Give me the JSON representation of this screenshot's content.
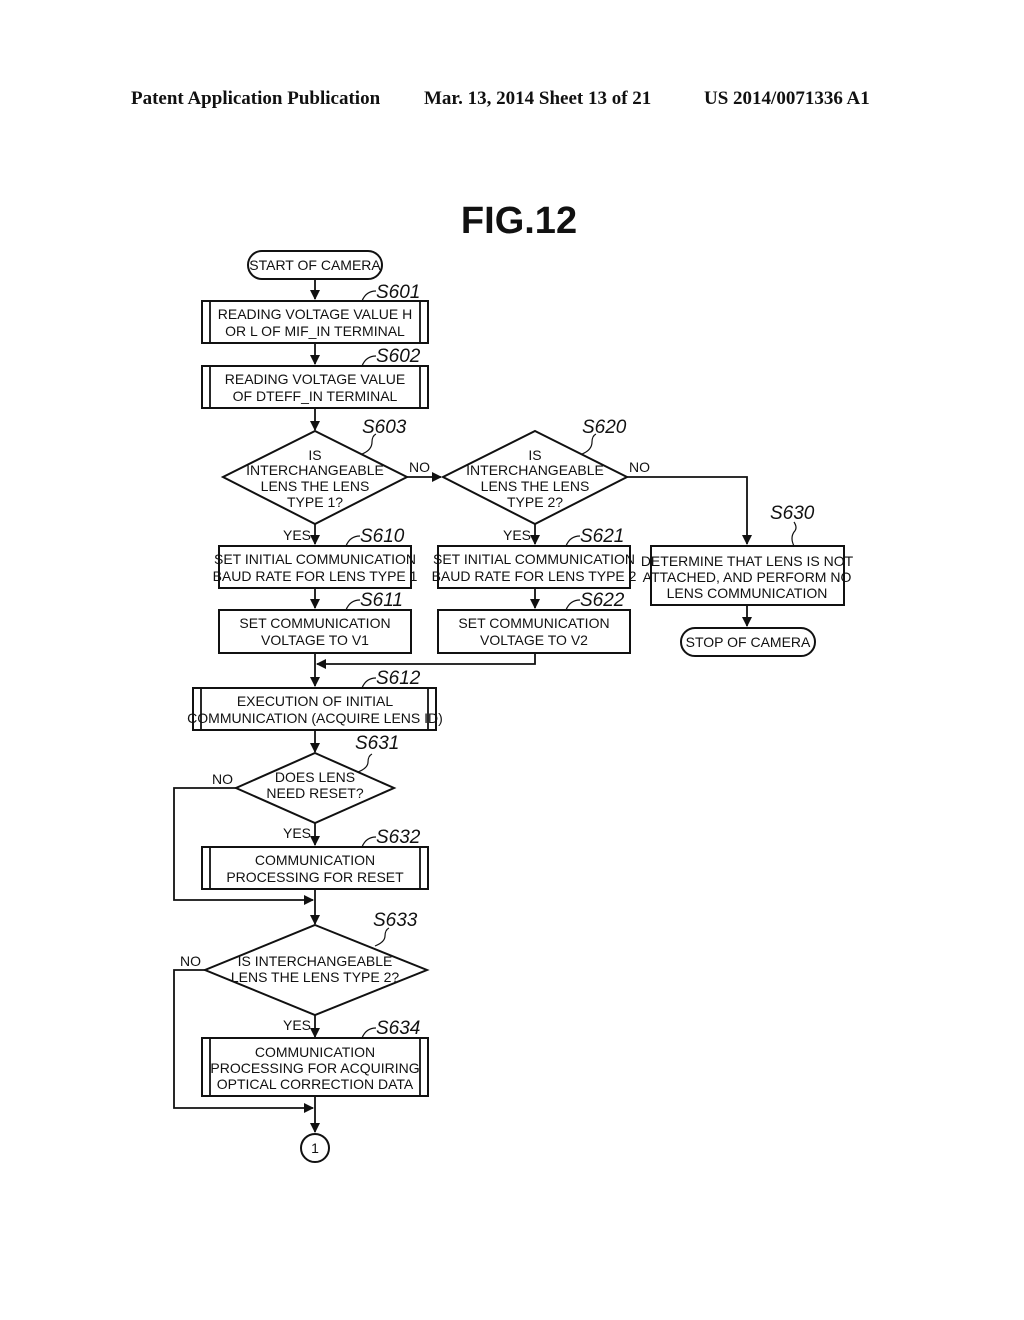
{
  "header": {
    "publication": "Patent Application Publication",
    "date_sheet": "Mar. 13, 2014  Sheet 13 of 21",
    "patent_number": "US 2014/0071336 A1"
  },
  "figure": {
    "title": "FIG.12",
    "nodes": {
      "start": {
        "text": [
          "START OF CAMERA"
        ]
      },
      "s601": {
        "step": "S601",
        "text": [
          "READING VOLTAGE VALUE H",
          "OR L OF MIF_IN TERMINAL"
        ]
      },
      "s602": {
        "step": "S602",
        "text": [
          "READING VOLTAGE VALUE",
          "OF DTEFF_IN TERMINAL"
        ]
      },
      "s603": {
        "step": "S603",
        "text": [
          "IS",
          "INTERCHANGEABLE",
          "LENS THE LENS",
          "TYPE 1?"
        ]
      },
      "s620": {
        "step": "S620",
        "text": [
          "IS",
          "INTERCHANGEABLE",
          "LENS THE LENS",
          "TYPE 2?"
        ]
      },
      "s610": {
        "step": "S610",
        "text": [
          "SET INITIAL COMMUNICATION",
          "BAUD RATE FOR LENS TYPE 1"
        ]
      },
      "s621": {
        "step": "S621",
        "text": [
          "SET INITIAL COMMUNICATION",
          "BAUD RATE FOR LENS TYPE 2"
        ]
      },
      "s630": {
        "step": "S630",
        "text": [
          "DETERMINE THAT LENS IS NOT",
          "ATTACHED, AND PERFORM NO",
          "LENS COMMUNICATION"
        ]
      },
      "stop": {
        "text": [
          "STOP OF CAMERA"
        ]
      },
      "s611": {
        "step": "S611",
        "text": [
          "SET COMMUNICATION",
          "VOLTAGE TO V1"
        ]
      },
      "s622": {
        "step": "S622",
        "text": [
          "SET COMMUNICATION",
          "VOLTAGE TO V2"
        ]
      },
      "s612": {
        "step": "S612",
        "text": [
          "EXECUTION OF INITIAL",
          "COMMUNICATION (ACQUIRE LENS ID)"
        ]
      },
      "s631": {
        "step": "S631",
        "text": [
          "DOES LENS",
          "NEED RESET?"
        ]
      },
      "s632": {
        "step": "S632",
        "text": [
          "COMMUNICATION",
          "PROCESSING FOR RESET"
        ]
      },
      "s633": {
        "step": "S633",
        "text": [
          "IS INTERCHANGEABLE",
          "LENS THE LENS TYPE 2?"
        ]
      },
      "s634": {
        "step": "S634",
        "text": [
          "COMMUNICATION",
          "PROCESSING FOR ACQUIRING",
          "OPTICAL CORRECTION DATA"
        ]
      },
      "connector": {
        "text": [
          "1"
        ]
      }
    },
    "branch_labels": {
      "yes": "YES",
      "no": "NO"
    }
  }
}
